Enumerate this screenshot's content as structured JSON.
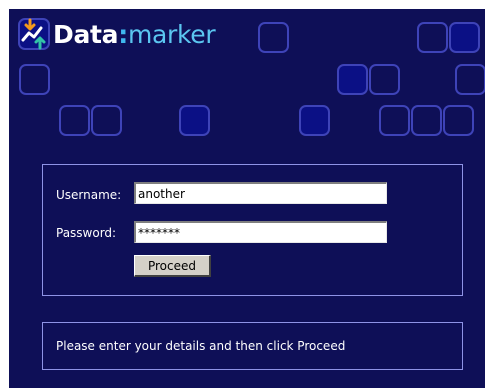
{
  "logo": {
    "word": "Data",
    "colon": ":",
    "suffix": "marker"
  },
  "login": {
    "username_label": "Username:",
    "username_value": "another",
    "password_label": "Password:",
    "password_value": "*******",
    "proceed_label": "Proceed"
  },
  "message": {
    "text": "Please enter your details and then click Proceed"
  },
  "colors": {
    "background": "#0e0f57",
    "tile_outline": "#3e43b8",
    "tile_fill": "#0b1085",
    "panel_border": "#8e93e6",
    "logo_accent": "#3fb8ee"
  }
}
